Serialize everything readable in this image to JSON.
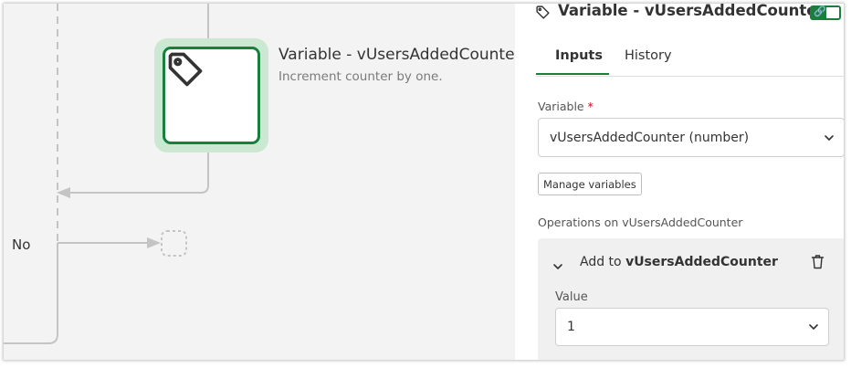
{
  "canvas": {
    "node": {
      "icon": "tag-icon",
      "title": "Variable - vUsersAddedCounter",
      "subtitle": "Increment counter by one."
    },
    "branch_label": "No"
  },
  "panel": {
    "header": {
      "icon": "tag-icon",
      "title": "Variable - vUsersAddedCounter",
      "toggle_icon": "link-icon",
      "toggle_on": true
    },
    "tabs": [
      {
        "label": "Inputs",
        "active": true
      },
      {
        "label": "History",
        "active": false
      }
    ],
    "variable_field": {
      "label": "Variable",
      "required_mark": "*",
      "value": "vUsersAddedCounter (number)"
    },
    "manage_button": "Manage variables",
    "operations": {
      "label": "Operations on vUsersAddedCounter",
      "items": [
        {
          "action": "Add to",
          "target": "vUsersAddedCounter",
          "value_label": "Value",
          "value": "1"
        }
      ]
    }
  },
  "colors": {
    "accent": "#1a7f3c",
    "node_glow": "#cde8d2",
    "canvas_bg": "#f3f3f3",
    "connector": "#c4c4c4"
  }
}
